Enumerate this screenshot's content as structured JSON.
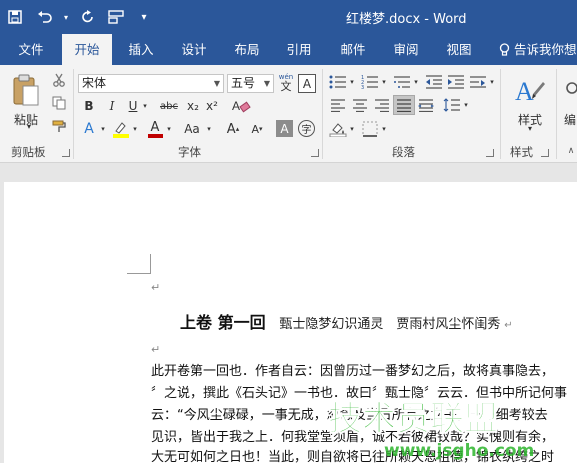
{
  "window": {
    "title": "红楼梦.docx - Word"
  },
  "qat": {
    "save": "save-icon",
    "undo": "undo-icon",
    "redo": "redo-icon",
    "layout": "layout-icon",
    "customize": "▾"
  },
  "tabs": [
    {
      "label": "文件"
    },
    {
      "label": "开始",
      "active": true
    },
    {
      "label": "插入"
    },
    {
      "label": "设计"
    },
    {
      "label": "布局"
    },
    {
      "label": "引用"
    },
    {
      "label": "邮件"
    },
    {
      "label": "审阅"
    },
    {
      "label": "视图"
    }
  ],
  "tell_me": "告诉我你想",
  "ribbon": {
    "clipboard": {
      "label": "剪贴板",
      "paste": "粘贴"
    },
    "font": {
      "label": "字体",
      "font_name": "宋体",
      "font_size": "五号",
      "wen": "wén",
      "wen_char": "文",
      "aa": "Aa",
      "bold": "B",
      "italic": "I",
      "underline": "U",
      "strike": "abc",
      "sub": "x₂",
      "sup": "x²",
      "grow": "A",
      "shrink": "A",
      "shade_a": "A",
      "enclose": "字",
      "text_effect": "A",
      "font_color": "A"
    },
    "paragraph": {
      "label": "段落"
    },
    "styles": {
      "label": "样式",
      "style_btn": "样式",
      "edit_btn": "编"
    }
  },
  "document": {
    "heading_main": "上卷 第一回",
    "heading_sub": "甄士隐梦幻识通灵　贾雨村风尘怀闺秀",
    "lines": [
      "此开卷第一回也．作者自云：因曾历过一番梦幻之后，故将真事隐去，",
      "〞之说，撰此《石头记》一书也．故曰〞甄士隐〞云云．但书中所记何事",
      "云：“今风尘碌碌，一事无成，忽念及当日所有之女子，一一细考较去",
      "见识，皆出于我之上．何我堂堂须眉，诚不若彼裙钗哉？实愧则有余，",
      "大无可如何之日也！当此，则自欲将已往所赖天恩祖德，锦衣纨绔之时"
    ]
  },
  "watermark": {
    "cn": "技术员联盟",
    "url": "www.jsgho.com"
  },
  "colors": {
    "title_bar": "#2b579a",
    "ribbon": "#f3f3f3",
    "highlight": "#ffff00",
    "font_color": "#c00000"
  }
}
